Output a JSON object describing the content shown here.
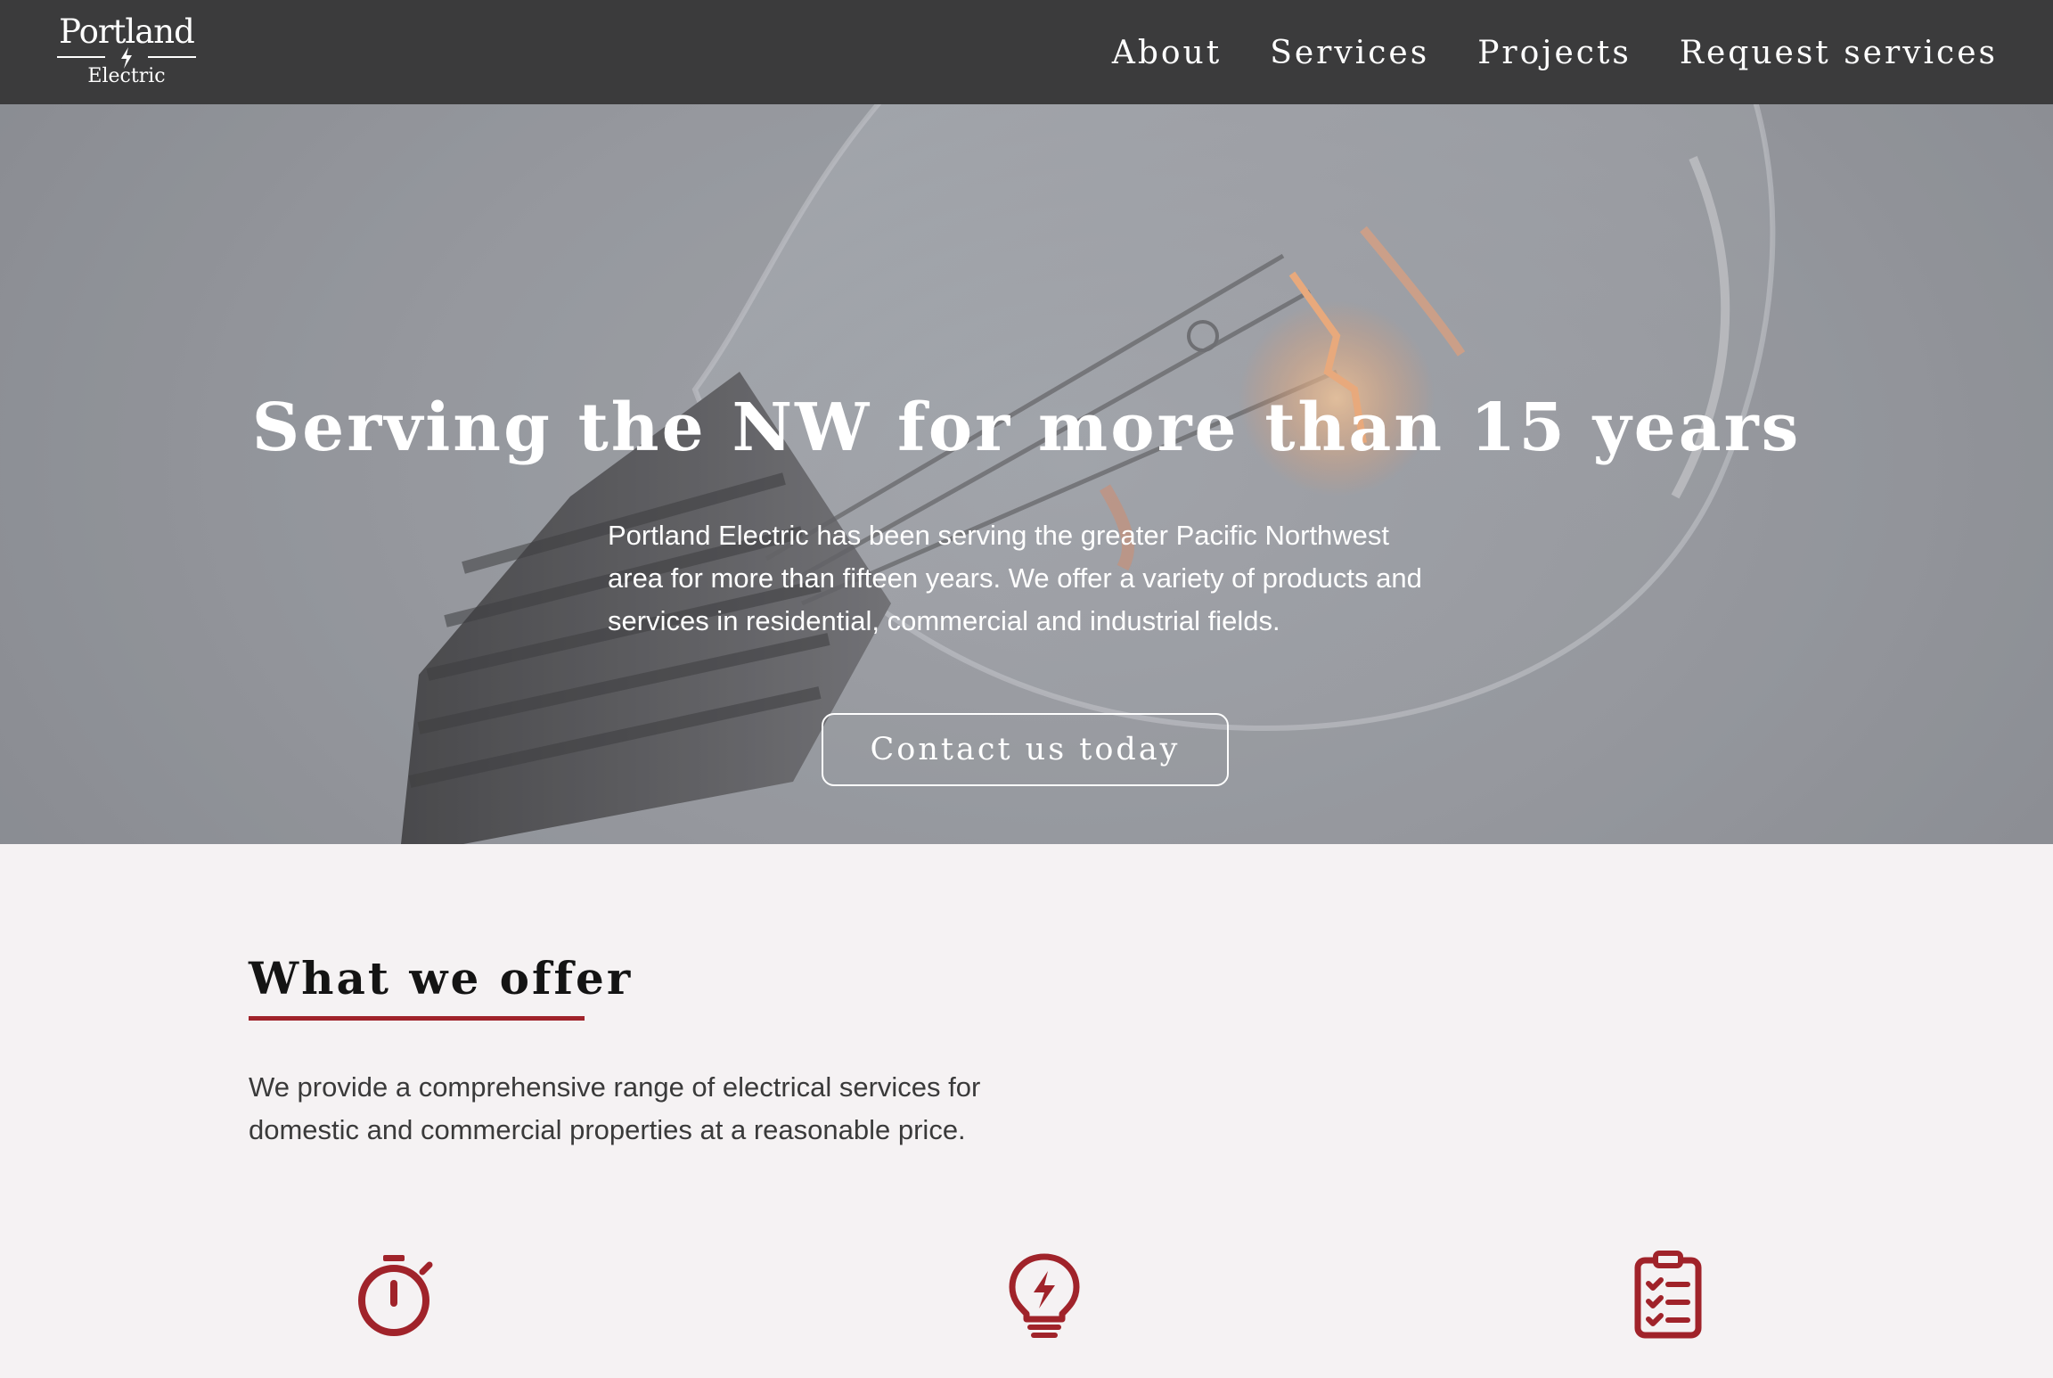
{
  "brand": {
    "name": "Portland",
    "sub": "Electric"
  },
  "nav": {
    "items": [
      "About",
      "Services",
      "Projects",
      "Request services"
    ]
  },
  "hero": {
    "title": "Serving the NW for more than 15 years",
    "body_lines": [
      "Portland Electric has been serving the greater Pacific Northwest",
      "area for more than fifteen years.  We offer a variety of products and",
      "services in residential, commercial and industrial fields."
    ],
    "cta": "Contact us today"
  },
  "offer": {
    "title": "What we offer",
    "body_lines": [
      "We provide a comprehensive range of electrical services for",
      "domestic and commercial properties at a reasonable price."
    ],
    "icons": [
      "stopwatch-icon",
      "lightbulb-bolt-icon",
      "clipboard-checklist-icon"
    ]
  },
  "colors": {
    "nav_bg": "#3b3b3c",
    "accent": "#a0232a",
    "page_bg": "#f5f2f3"
  }
}
